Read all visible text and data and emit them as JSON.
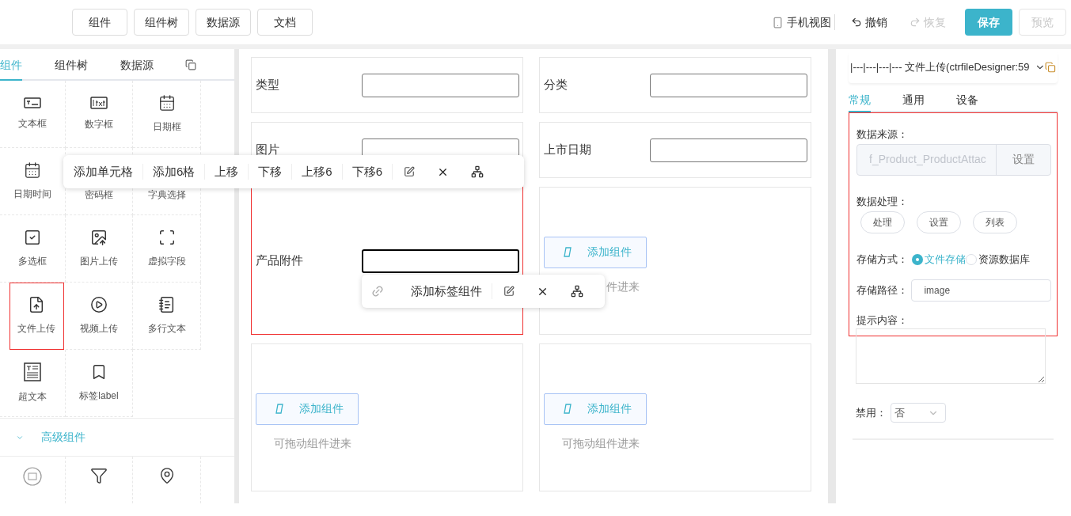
{
  "top_bar": {
    "buttons": [
      "组件",
      "组件树",
      "数据源",
      "文档"
    ],
    "actions": [
      {
        "kind": "phone",
        "label": "手机视图",
        "disabled": false
      },
      {
        "kind": "undo",
        "label": "撤销",
        "disabled": false
      },
      {
        "kind": "redo",
        "label": "恢复",
        "disabled": true
      },
      {
        "kind": "primary",
        "label": "保存",
        "disabled": false
      },
      {
        "kind": "outline",
        "label": "预览",
        "disabled": true
      }
    ]
  },
  "left_panel": {
    "tabs": [
      {
        "label": "组件",
        "selected": true
      },
      {
        "label": "组件树",
        "selected": false
      },
      {
        "label": "数据源",
        "selected": false
      }
    ],
    "components": [
      {
        "label": "文本框",
        "selected": false
      },
      {
        "label": "数字框",
        "selected": false
      },
      {
        "label": "日期框",
        "selected": false
      },
      {
        "label": "日期时间",
        "selected": false
      },
      {
        "label": "密码框",
        "selected": false
      },
      {
        "label": "字典选择",
        "selected": false
      },
      {
        "label": "多选框",
        "selected": false
      },
      {
        "label": "图片上传",
        "selected": false
      },
      {
        "label": "虚拟字段",
        "selected": false
      },
      {
        "label": "文件上传",
        "selected": true
      },
      {
        "label": "视频上传",
        "selected": false
      },
      {
        "label": "多行文本",
        "selected": false
      },
      {
        "label": "超文本",
        "selected": false
      },
      {
        "label": "标签label",
        "selected": false
      }
    ],
    "advanced": {
      "title": "高级组件",
      "expanded": true
    }
  },
  "canvas": {
    "rows": [
      [
        {
          "kind": "field",
          "label": "类型",
          "selected": false
        },
        {
          "kind": "field",
          "label": "分类",
          "selected": false
        }
      ],
      [
        {
          "kind": "field",
          "label": "图片",
          "selected": false
        },
        {
          "kind": "field",
          "label": "上市日期",
          "selected": false
        }
      ],
      [
        {
          "kind": "field",
          "label": "产品附件",
          "selected": true
        },
        {
          "kind": "drop",
          "button": "添加组件",
          "hint": "件进来"
        }
      ],
      [
        {
          "kind": "drop",
          "button": "添加组件",
          "hint": "可拖动组件进来"
        },
        {
          "kind": "drop",
          "button": "添加组件",
          "hint": "可拖动组件进来"
        }
      ]
    ],
    "cell_toolbar": [
      {
        "kind": "text",
        "label": "添加单元格"
      },
      {
        "kind": "text",
        "label": "添加6格"
      },
      {
        "kind": "text",
        "label": "上移"
      },
      {
        "kind": "text",
        "label": "下移"
      },
      {
        "kind": "text",
        "label": "上移6"
      },
      {
        "kind": "text",
        "label": "下移6"
      },
      {
        "kind": "edit"
      },
      {
        "kind": "close"
      },
      {
        "kind": "tree"
      }
    ],
    "field_toolbar": [
      {
        "kind": "link"
      },
      {
        "kind": "text",
        "label": "添加标签组件"
      },
      {
        "kind": "edit"
      },
      {
        "kind": "close"
      },
      {
        "kind": "tree"
      }
    ]
  },
  "properties": {
    "component_select": "|---|---|---|--- 文件上传(ctrfileDesigner:59",
    "tabs": [
      {
        "label": "常规",
        "selected": true
      },
      {
        "label": "通用",
        "selected": false
      },
      {
        "label": "设备",
        "selected": false
      }
    ],
    "outlined": true,
    "data_source": {
      "label": "数据来源：",
      "value": "f_Product_ProductAttac",
      "button": "设置",
      "disabled": true
    },
    "data_processing": {
      "label": "数据处理：",
      "buttons": [
        "处理",
        "设置",
        "列表"
      ]
    },
    "storage_mode": {
      "label": "存储方式：",
      "options": [
        {
          "label": "文件存储",
          "selected": true
        },
        {
          "label": "资源数据库",
          "selected": false
        }
      ]
    },
    "storage_path": {
      "label": "存储路径：",
      "value": "image"
    },
    "hint_content": {
      "label": "提示内容："
    },
    "disable": {
      "label": "禁用：",
      "value": "否"
    }
  }
}
